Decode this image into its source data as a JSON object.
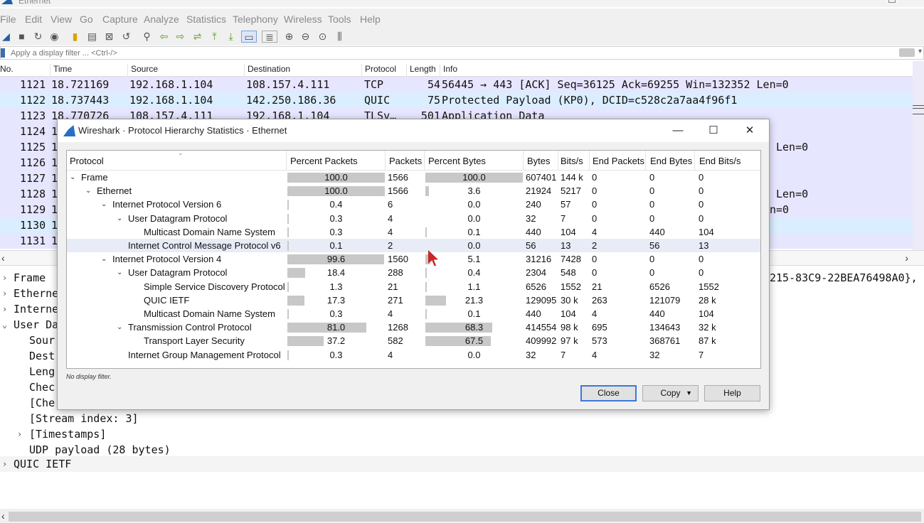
{
  "window": {
    "title": "Ethernet"
  },
  "menu": [
    "File",
    "Edit",
    "View",
    "Go",
    "Capture",
    "Analyze",
    "Statistics",
    "Telephony",
    "Wireless",
    "Tools",
    "Help"
  ],
  "filter": {
    "placeholder": "Apply a display filter ... <Ctrl-/>",
    "value": ""
  },
  "packet_list": {
    "columns": [
      "No.",
      "Time",
      "Source",
      "Destination",
      "Protocol",
      "Length",
      "Info"
    ],
    "rows": [
      {
        "no": "1121",
        "time": "18.721169",
        "src": "192.168.1.104",
        "dst": "108.157.4.111",
        "proto": "TCP",
        "len": "54",
        "info": "56445 → 443 [ACK] Seq=36125 Ack=69255 Win=132352 Len=0"
      },
      {
        "no": "1122",
        "time": "18.737443",
        "src": "192.168.1.104",
        "dst": "142.250.186.36",
        "proto": "QUIC",
        "len": "75",
        "info": "Protected Payload (KP0), DCID=c528c2a7aa4f96f1"
      },
      {
        "no": "1123",
        "time": "18.770726",
        "src": "108.157.4.111",
        "dst": "192.168.1.104",
        "proto": "TLSv…",
        "len": "501",
        "info": "Application Data"
      },
      {
        "no": "1124",
        "time": "1",
        "src": "",
        "dst": "",
        "proto": "",
        "len": "",
        "info": ""
      },
      {
        "no": "1125",
        "time": "1",
        "src": "",
        "dst": "",
        "proto": "",
        "len": "",
        "info": "Len=0"
      },
      {
        "no": "1126",
        "time": "1",
        "src": "",
        "dst": "",
        "proto": "",
        "len": "",
        "info": ""
      },
      {
        "no": "1127",
        "time": "1",
        "src": "",
        "dst": "",
        "proto": "",
        "len": "",
        "info": ""
      },
      {
        "no": "1128",
        "time": "1",
        "src": "",
        "dst": "",
        "proto": "",
        "len": "",
        "info": "Len=0"
      },
      {
        "no": "1129",
        "time": "1",
        "src": "",
        "dst": "",
        "proto": "",
        "len": "",
        "info": "n=0"
      },
      {
        "no": "1130",
        "time": "1",
        "src": "",
        "dst": "",
        "proto": "",
        "len": "",
        "info": ""
      },
      {
        "no": "1131",
        "time": "1",
        "src": "",
        "dst": "",
        "proto": "",
        "len": "",
        "info": ""
      }
    ]
  },
  "details": {
    "rows": [
      {
        "exp": "›",
        "text": "Frame"
      },
      {
        "exp": "›",
        "text": "Etherne"
      },
      {
        "exp": "›",
        "text": "Interne"
      },
      {
        "exp": "⌄",
        "text": "User Da"
      },
      {
        "exp": "",
        "text": "Sour"
      },
      {
        "exp": "",
        "text": "Dest"
      },
      {
        "exp": "",
        "text": "Leng"
      },
      {
        "exp": "",
        "text": "Chec"
      },
      {
        "exp": "",
        "text": "[Che"
      },
      {
        "exp": "",
        "text": "[Stream index: 3]"
      },
      {
        "exp": "›",
        "text": "[Timestamps]"
      },
      {
        "exp": "",
        "text": "UDP payload (28 bytes)"
      },
      {
        "exp": "›",
        "text": "QUIC IETF"
      }
    ],
    "right_text": "215-83C9-22BEA76498A0},"
  },
  "dialog": {
    "title": "Wireshark · Protocol Hierarchy Statistics · Ethernet",
    "columns": [
      "Protocol",
      "Percent Packets",
      "Packets",
      "Percent Bytes",
      "Bytes",
      "Bits/s",
      "End Packets",
      "End Bytes",
      "End Bits/s"
    ],
    "rows": [
      {
        "level": 0,
        "expander": "⌄",
        "protocol": "Frame",
        "pct_packets": "100.0",
        "pct_packets_value": 100.0,
        "packets": "1566",
        "pct_bytes": "100.0",
        "pct_bytes_value": 100.0,
        "bytes": "607401",
        "bits": "144 k",
        "end_packets": "0",
        "end_bytes": "0",
        "end_bits": "0"
      },
      {
        "level": 1,
        "expander": "⌄",
        "protocol": "Ethernet",
        "pct_packets": "100.0",
        "pct_packets_value": 100.0,
        "packets": "1566",
        "pct_bytes": "3.6",
        "pct_bytes_value": 3.6,
        "bytes": "21924",
        "bits": "5217",
        "end_packets": "0",
        "end_bytes": "0",
        "end_bits": "0"
      },
      {
        "level": 2,
        "expander": "⌄",
        "protocol": "Internet Protocol Version 6",
        "pct_packets": "0.4",
        "pct_packets_value": 0.4,
        "packets": "6",
        "pct_bytes": "0.0",
        "pct_bytes_value": 0.0,
        "bytes": "240",
        "bits": "57",
        "end_packets": "0",
        "end_bytes": "0",
        "end_bits": "0"
      },
      {
        "level": 3,
        "expander": "⌄",
        "protocol": "User Datagram Protocol",
        "pct_packets": "0.3",
        "pct_packets_value": 0.3,
        "packets": "4",
        "pct_bytes": "0.0",
        "pct_bytes_value": 0.0,
        "bytes": "32",
        "bits": "7",
        "end_packets": "0",
        "end_bytes": "0",
        "end_bits": "0"
      },
      {
        "level": 4,
        "expander": "",
        "protocol": "Multicast Domain Name System",
        "pct_packets": "0.3",
        "pct_packets_value": 0.3,
        "packets": "4",
        "pct_bytes": "0.1",
        "pct_bytes_value": 0.1,
        "bytes": "440",
        "bits": "104",
        "end_packets": "4",
        "end_bytes": "440",
        "end_bits": "104"
      },
      {
        "level": 3,
        "expander": "",
        "protocol": "Internet Control Message Protocol v6",
        "pct_packets": "0.1",
        "pct_packets_value": 0.1,
        "packets": "2",
        "pct_bytes": "0.0",
        "pct_bytes_value": 0.0,
        "bytes": "56",
        "bits": "13",
        "end_packets": "2",
        "end_bytes": "56",
        "end_bits": "13",
        "selected": true
      },
      {
        "level": 2,
        "expander": "⌄",
        "protocol": "Internet Protocol Version 4",
        "pct_packets": "99.6",
        "pct_packets_value": 99.6,
        "packets": "1560",
        "pct_bytes": "5.1",
        "pct_bytes_value": 5.1,
        "bytes": "31216",
        "bits": "7428",
        "end_packets": "0",
        "end_bytes": "0",
        "end_bits": "0"
      },
      {
        "level": 3,
        "expander": "⌄",
        "protocol": "User Datagram Protocol",
        "pct_packets": "18.4",
        "pct_packets_value": 18.4,
        "packets": "288",
        "pct_bytes": "0.4",
        "pct_bytes_value": 0.4,
        "bytes": "2304",
        "bits": "548",
        "end_packets": "0",
        "end_bytes": "0",
        "end_bits": "0"
      },
      {
        "level": 4,
        "expander": "",
        "protocol": "Simple Service Discovery Protocol",
        "pct_packets": "1.3",
        "pct_packets_value": 1.3,
        "packets": "21",
        "pct_bytes": "1.1",
        "pct_bytes_value": 1.1,
        "bytes": "6526",
        "bits": "1552",
        "end_packets": "21",
        "end_bytes": "6526",
        "end_bits": "1552"
      },
      {
        "level": 4,
        "expander": "",
        "protocol": "QUIC IETF",
        "pct_packets": "17.3",
        "pct_packets_value": 17.3,
        "packets": "271",
        "pct_bytes": "21.3",
        "pct_bytes_value": 21.3,
        "bytes": "129095",
        "bits": "30 k",
        "end_packets": "263",
        "end_bytes": "121079",
        "end_bits": "28 k"
      },
      {
        "level": 4,
        "expander": "",
        "protocol": "Multicast Domain Name System",
        "pct_packets": "0.3",
        "pct_packets_value": 0.3,
        "packets": "4",
        "pct_bytes": "0.1",
        "pct_bytes_value": 0.1,
        "bytes": "440",
        "bits": "104",
        "end_packets": "4",
        "end_bytes": "440",
        "end_bits": "104"
      },
      {
        "level": 3,
        "expander": "⌄",
        "protocol": "Transmission Control Protocol",
        "pct_packets": "81.0",
        "pct_packets_value": 81.0,
        "packets": "1268",
        "pct_bytes": "68.3",
        "pct_bytes_value": 68.3,
        "bytes": "414554",
        "bits": "98 k",
        "end_packets": "695",
        "end_bytes": "134643",
        "end_bits": "32 k"
      },
      {
        "level": 4,
        "expander": "",
        "protocol": "Transport Layer Security",
        "pct_packets": "37.2",
        "pct_packets_value": 37.2,
        "packets": "582",
        "pct_bytes": "67.5",
        "pct_bytes_value": 67.5,
        "bytes": "409992",
        "bits": "97 k",
        "end_packets": "573",
        "end_bytes": "368761",
        "end_bits": "87 k"
      },
      {
        "level": 3,
        "expander": "",
        "protocol": "Internet Group Management Protocol",
        "pct_packets": "0.3",
        "pct_packets_value": 0.3,
        "packets": "4",
        "pct_bytes": "0.0",
        "pct_bytes_value": 0.0,
        "bytes": "32",
        "bits": "7",
        "end_packets": "4",
        "end_bytes": "32",
        "end_bits": "7"
      }
    ],
    "status": "No display filter.",
    "buttons": {
      "close": "Close",
      "copy": "Copy",
      "help": "Help"
    }
  },
  "colors": {
    "row_udp": "#daeeff",
    "row_tcp": "#e7e6ff",
    "bar": "#c8c8c8",
    "accent": "#3c78d8"
  }
}
